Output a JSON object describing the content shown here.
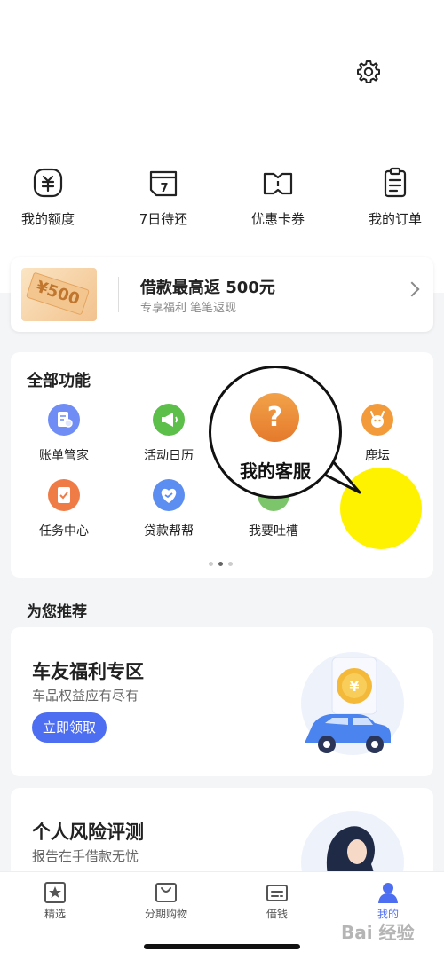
{
  "header": {
    "settings_icon": "gear-icon"
  },
  "quick_actions": [
    {
      "label": "我的额度",
      "icon": "quota-icon"
    },
    {
      "label": "7日待还",
      "icon": "calendar-7-icon",
      "badge": "7"
    },
    {
      "label": "优惠卡券",
      "icon": "coupon-icon"
    },
    {
      "label": "我的订单",
      "icon": "order-clipboard-icon"
    }
  ],
  "promo": {
    "ticket_text": "¥500",
    "title_prefix": "借款最高返",
    "title_amount": "500",
    "title_suffix": "元",
    "subtitle": "专享福利 笔笔返现"
  },
  "functions": {
    "title": "全部功能",
    "items": [
      {
        "label": "账单管家",
        "icon": "bill-icon",
        "color": "#6f8df5"
      },
      {
        "label": "活动日历",
        "icon": "megaphone-icon",
        "color": "#5cbf4a"
      },
      {
        "label": "鹿坛",
        "icon": "deer-icon",
        "color": "#f39a3a"
      },
      {
        "label": "任务中心",
        "icon": "task-icon",
        "color": "#ef7c46"
      },
      {
        "label": "贷款帮帮",
        "icon": "heart-icon",
        "color": "#5b8ef0"
      },
      {
        "label": "我要吐槽",
        "icon": "feedback-icon",
        "color": "#7cc56a"
      },
      {
        "label": "我的客服",
        "icon": "question-icon",
        "color": "#f0a03a"
      }
    ],
    "page_dots": 3,
    "active_dot": 2
  },
  "callout": {
    "label": "我的客服",
    "glyph": "?"
  },
  "recommend": {
    "title": "为您推荐",
    "cards": [
      {
        "title": "车友福利专区",
        "subtitle": "车品权益应有尽有",
        "button": "立即领取",
        "illustration": "car-coin-illustration"
      },
      {
        "title": "个人风险评测",
        "subtitle": "报告在手借款无忧",
        "illustration": "woman-avatar-illustration"
      }
    ]
  },
  "tabbar": {
    "tabs": [
      {
        "label": "精选",
        "icon": "star-icon"
      },
      {
        "label": "分期购物",
        "icon": "shopping-bag-icon"
      },
      {
        "label": "借钱",
        "icon": "wallet-icon"
      },
      {
        "label": "我的",
        "icon": "user-icon",
        "active": true
      }
    ]
  },
  "watermark": "Bai 经验",
  "colors": {
    "accent": "#4e6ef2",
    "highlight": "#fff200",
    "orange": "#e57a2c"
  }
}
